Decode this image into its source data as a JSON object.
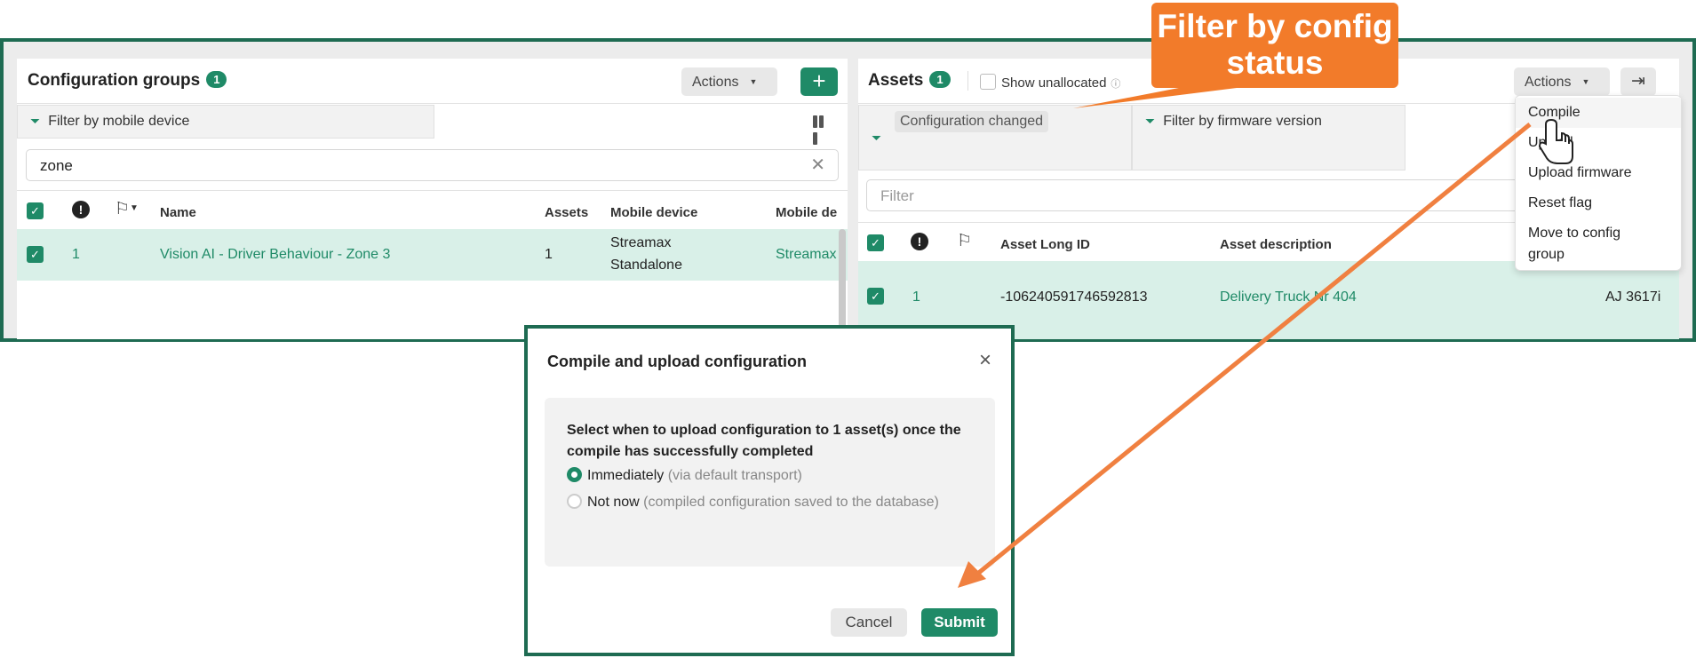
{
  "left_panel": {
    "title": "Configuration groups",
    "count": "1",
    "actions_label": "Actions",
    "add_label": "+",
    "filter_tab": "Filter by mobile device",
    "search_value": "zone",
    "columns": [
      "Name",
      "Assets",
      "Mobile device",
      "Mobile de"
    ],
    "row": {
      "number": "1",
      "name": "Vision AI - Driver Behaviour - Zone 3",
      "assets": "1",
      "mobile_device_1": "Streamax",
      "mobile_device_2": "Standalone",
      "mobile_de": "Streamax"
    }
  },
  "right_panel": {
    "title": "Assets",
    "count": "1",
    "show_unallocated": "Show unallocated",
    "actions_label": "Actions",
    "filter_tab_1": "Configuration changed",
    "filter_tab_2": "Filter by firmware version",
    "filter_placeholder": "Filter",
    "columns": [
      "Asset Long ID",
      "Asset description"
    ],
    "row": {
      "number": "1",
      "long_id": "-106240591746592813",
      "description": "Delivery Truck Nr 404",
      "extra": "AJ 3617i"
    }
  },
  "actions_menu": {
    "items": [
      "Compile",
      "Upload",
      "Upload firmware",
      "Reset flag",
      "Move to config",
      "group"
    ]
  },
  "dialog": {
    "title": "Compile and upload configuration",
    "question_1": "Select when to upload configuration to 1 asset(s) once the",
    "question_2": "compile has successfully completed",
    "option1_label": "Immediately",
    "option1_hint": "(via default transport)",
    "option2_label": "Not now",
    "option2_hint": "(compiled configuration saved to the database)",
    "cancel": "Cancel",
    "submit": "Submit"
  },
  "callout": {
    "line1": "Filter by config",
    "line2": "status"
  },
  "colors": {
    "accent": "#1f8a67",
    "frame": "#1e6b52",
    "callout": "#f27b2a",
    "row_selected": "#d9f0e8"
  }
}
